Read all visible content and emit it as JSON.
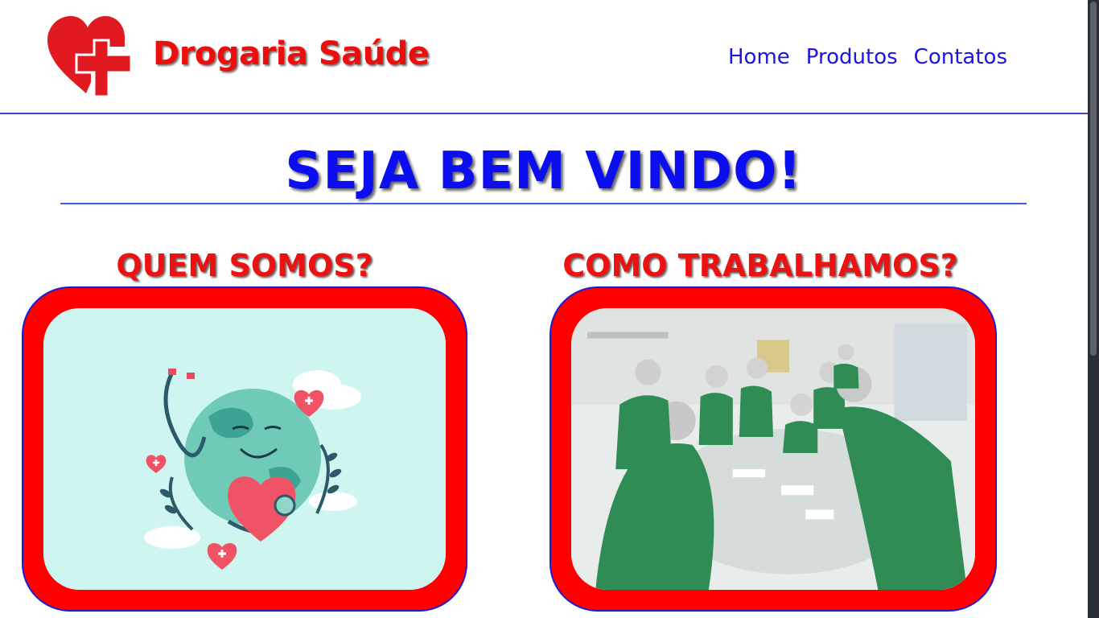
{
  "header": {
    "brand": "Drogaria Saúde",
    "logo_icon": "heart-cross-icon",
    "nav": [
      {
        "label": "Home"
      },
      {
        "label": "Produtos"
      },
      {
        "label": "Contatos"
      }
    ]
  },
  "main": {
    "welcome": "SEJA BEM VINDO!",
    "sections": [
      {
        "title": "QUEM SOMOS?",
        "image": "globe-heart-stethoscope-illustration"
      },
      {
        "title": "COMO TRABALHAMOS?",
        "image": "nurses-at-table-photo"
      }
    ]
  },
  "colors": {
    "brand_red": "#ee0d0d",
    "nav_blue": "#1c14e6",
    "welcome_blue": "#0a0ef0",
    "frame_red": "#ff0000",
    "divider_blue": "#3b44c8"
  }
}
